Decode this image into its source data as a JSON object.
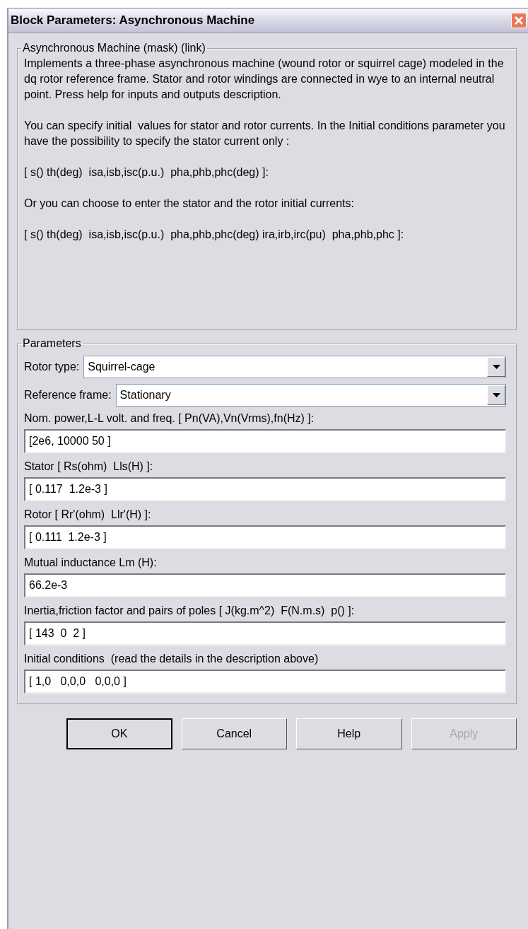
{
  "window": {
    "title": "Block Parameters: Asynchronous  Machine"
  },
  "description": {
    "title": "Asynchronous Machine (mask) (link)",
    "paragraphs": [
      "Implements a three-phase asynchronous machine (wound rotor or squirrel cage) modeled in the dq rotor reference frame. Stator and rotor windings are connected in wye to an internal neutral point. Press help for inputs and outputs description.",
      "You can specify initial  values for stator and rotor currents. In the Initial conditions parameter you have the possibility to specify the stator current only :",
      "[ s() th(deg)  isa,isb,isc(p.u.)  pha,phb,phc(deg) ]:",
      "Or you can choose to enter the stator and the rotor initial currents:",
      "[ s() th(deg)  isa,isb,isc(p.u.)  pha,phb,phc(deg) ira,irb,irc(pu)  pha,phb,phc ]:"
    ]
  },
  "parameters": {
    "title": "Parameters",
    "fields": [
      {
        "kind": "dropdown",
        "label": "Rotor type:",
        "value": "Squirrel-cage"
      },
      {
        "kind": "dropdown",
        "label": "Reference frame:",
        "value": "Stationary"
      },
      {
        "kind": "text",
        "label": "Nom. power,L-L volt. and freq. [ Pn(VA),Vn(Vrms),fn(Hz) ]:",
        "value": "[2e6, 10000 50 ]"
      },
      {
        "kind": "text",
        "label": "Stator [ Rs(ohm)  Lls(H) ]:",
        "value": "[ 0.117  1.2e-3 ]"
      },
      {
        "kind": "text",
        "label": "Rotor [ Rr'(ohm)  Llr'(H) ]:",
        "value": "[ 0.111  1.2e-3 ]"
      },
      {
        "kind": "text",
        "label": "Mutual inductance Lm (H):",
        "value": "66.2e-3"
      },
      {
        "kind": "text",
        "label": "Inertia,friction factor and pairs of poles [ J(kg.m^2)  F(N.m.s)  p() ]:",
        "value": "[ 143  0  2 ]"
      },
      {
        "kind": "text",
        "label": "Initial conditions  (read the details in the description above)",
        "value": "[ 1,0   0,0,0   0,0,0 ]"
      }
    ]
  },
  "buttons": [
    {
      "label": "OK",
      "disabled": false,
      "default": true
    },
    {
      "label": "Cancel",
      "disabled": false,
      "default": false
    },
    {
      "label": "Help",
      "disabled": false,
      "default": false
    },
    {
      "label": "Apply",
      "disabled": true,
      "default": false
    }
  ]
}
